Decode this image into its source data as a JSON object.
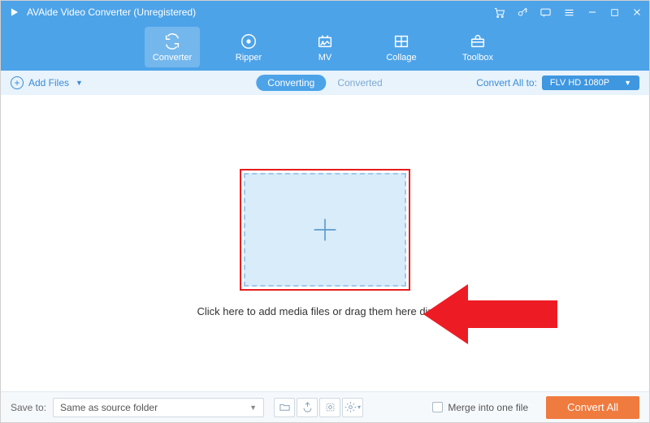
{
  "titlebar": {
    "title": "AVAide Video Converter (Unregistered)"
  },
  "toolbar": {
    "items": [
      {
        "label": "Converter"
      },
      {
        "label": "Ripper"
      },
      {
        "label": "MV"
      },
      {
        "label": "Collage"
      },
      {
        "label": "Toolbox"
      }
    ]
  },
  "subbar": {
    "add_files": "Add Files",
    "converting": "Converting",
    "converted": "Converted",
    "convert_all_to": "Convert All to:",
    "format": "FLV HD 1080P"
  },
  "main": {
    "drop_text": "Click here to add media files or drag them here directly"
  },
  "bottom": {
    "save_to_label": "Save to:",
    "save_to_value": "Same as source folder",
    "merge_label": "Merge into one file",
    "convert_btn": "Convert All"
  }
}
